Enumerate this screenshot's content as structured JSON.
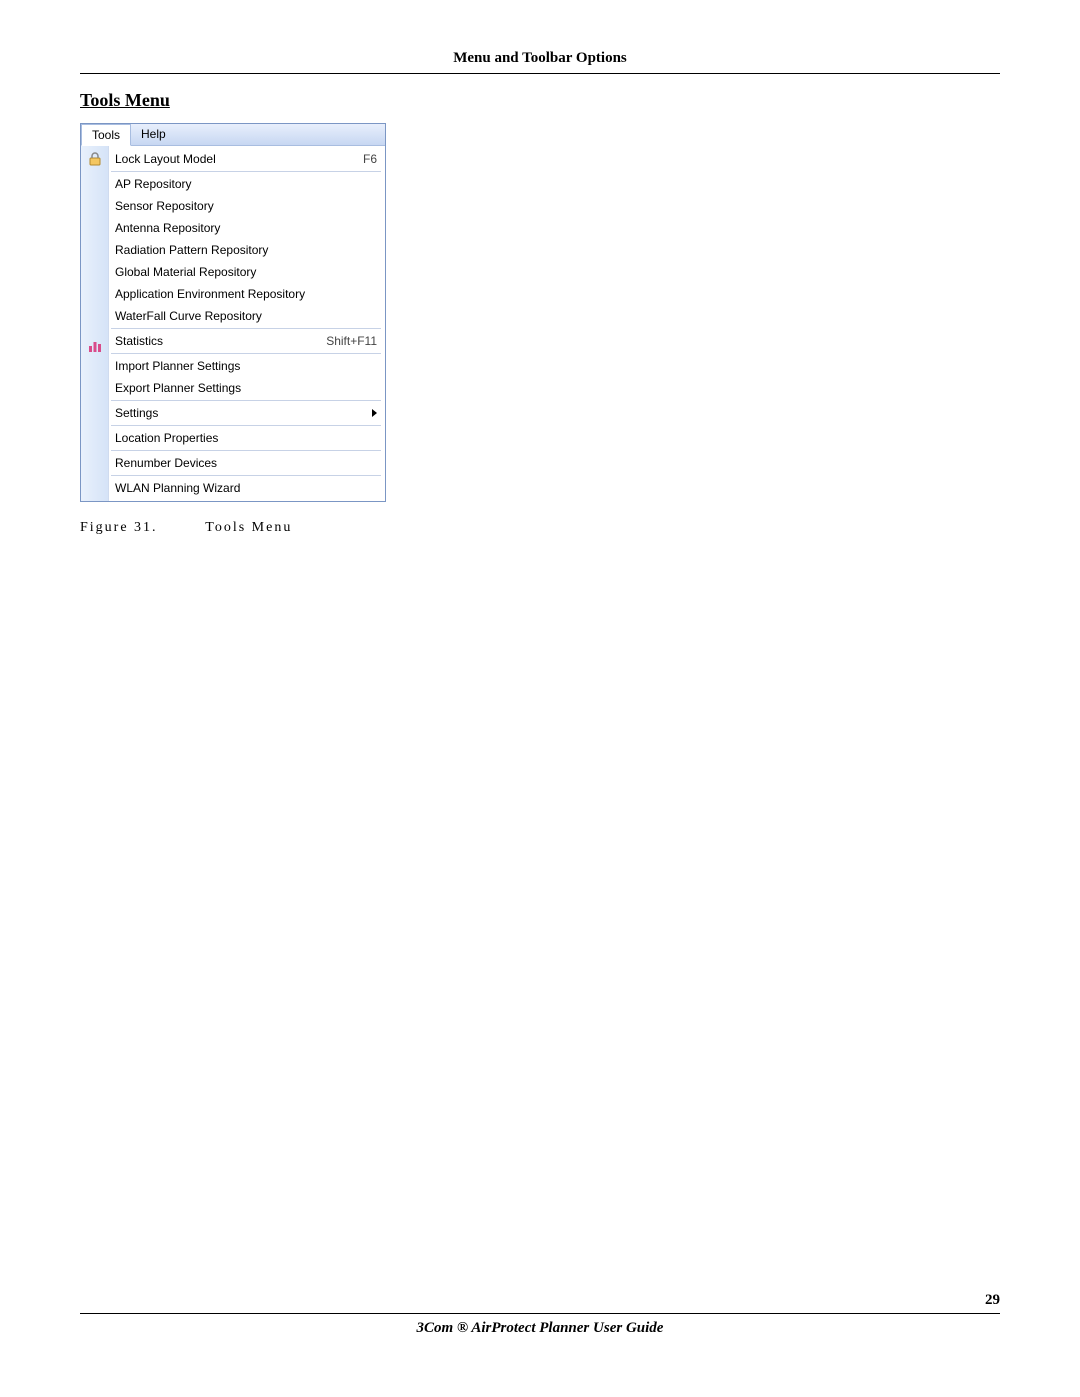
{
  "header": {
    "title": "Menu and Toolbar Options"
  },
  "section": {
    "title": "Tools Menu"
  },
  "menubar": {
    "tools": "Tools",
    "help": "Help"
  },
  "menu": {
    "groups": [
      [
        {
          "label": "Lock Layout Model",
          "accel": "F6",
          "icon": "lock"
        }
      ],
      [
        {
          "label": "AP Repository"
        },
        {
          "label": "Sensor Repository"
        },
        {
          "label": "Antenna Repository"
        },
        {
          "label": "Radiation Pattern Repository"
        },
        {
          "label": "Global Material Repository"
        },
        {
          "label": "Application Environment Repository"
        },
        {
          "label": "WaterFall Curve Repository"
        }
      ],
      [
        {
          "label": "Statistics",
          "accel": "Shift+F11",
          "icon": "stats"
        }
      ],
      [
        {
          "label": "Import Planner Settings"
        },
        {
          "label": "Export Planner Settings"
        }
      ],
      [
        {
          "label": "Settings",
          "submenu": true
        }
      ],
      [
        {
          "label": "Location Properties"
        }
      ],
      [
        {
          "label": "Renumber Devices"
        }
      ],
      [
        {
          "label": "WLAN Planning Wizard"
        }
      ]
    ]
  },
  "caption": {
    "prefix": "Figure 31.",
    "text": "Tools Menu"
  },
  "footer": {
    "text": "3Com ® AirProtect Planner User Guide",
    "page": "29"
  }
}
